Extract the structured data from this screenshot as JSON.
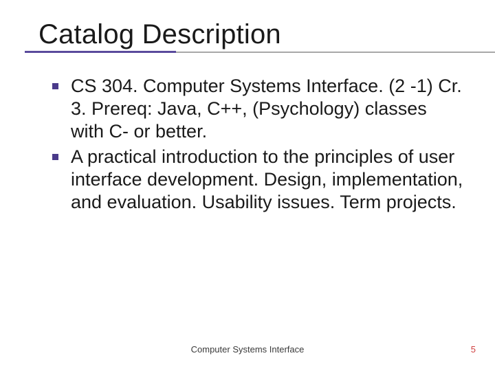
{
  "title": "Catalog Description",
  "bullets": [
    "CS 304. Computer Systems Interface. (2 -1) Cr. 3. Prereq: Java, C++, (Psychology) classes with C- or better.",
    "A practical introduction to the principles of user interface development. Design, implementation, and evaluation. Usability issues. Term projects."
  ],
  "footer": "Computer Systems Interface",
  "page_number": "5"
}
